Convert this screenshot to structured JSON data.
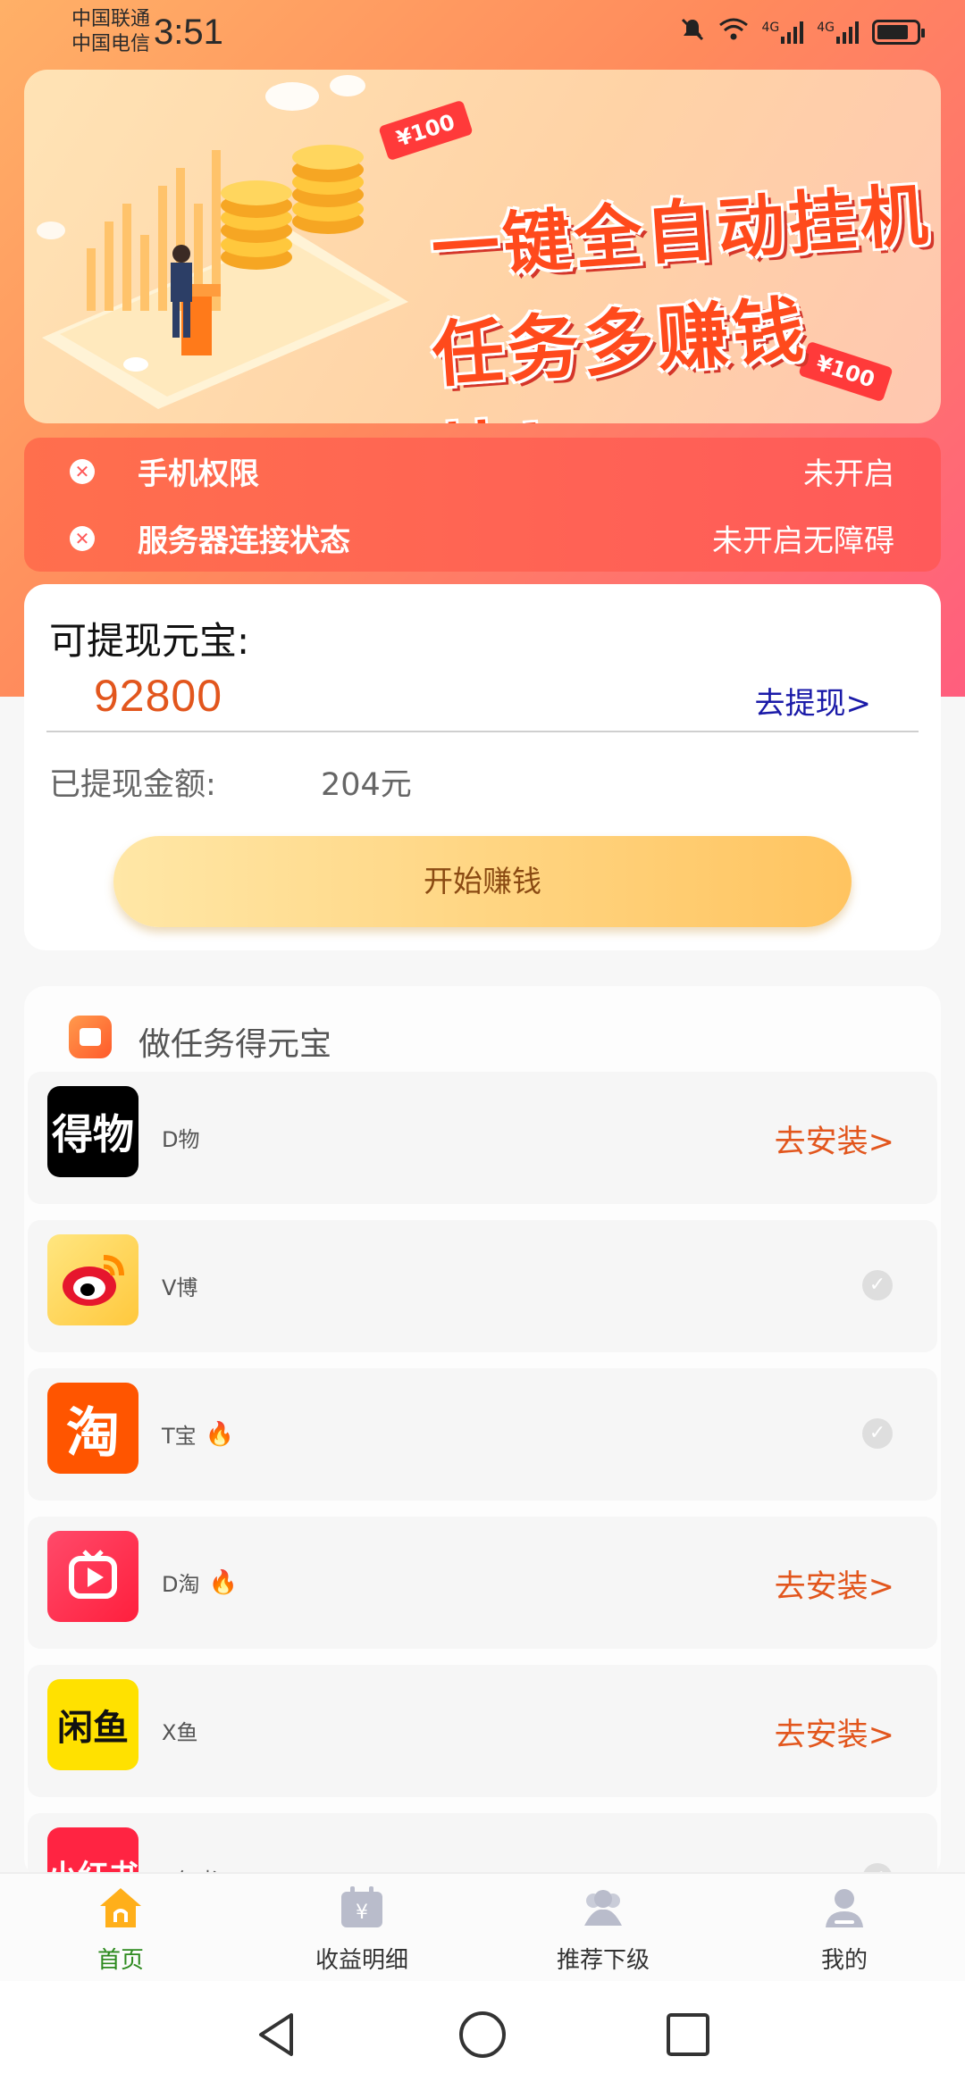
{
  "status_bar": {
    "carrier_1": "中国联通",
    "carrier_2": "中国电信",
    "time": "3:51",
    "net_1": "4G",
    "net_2": "4G"
  },
  "banner": {
    "headline_1": "一键全自动挂机",
    "headline_2": "任务多赚钱快！",
    "tag_1": "¥100",
    "tag_2": "¥100",
    "slide_count": 2,
    "active_slide": 2
  },
  "permissions": {
    "items": [
      {
        "label": "手机权限",
        "status": "未开启"
      },
      {
        "label": "服务器连接状态",
        "status": "未开启无障碍"
      }
    ]
  },
  "withdraw": {
    "title": "可提现元宝:",
    "amount": "92800",
    "link": "去提现>",
    "paid_label": "已提现金额:",
    "paid_value": "204元",
    "start_button": "开始赚钱"
  },
  "tasks": {
    "title": "做任务得元宝",
    "items": [
      {
        "icon_text": "得物",
        "name": "D物",
        "hot": false,
        "action": "去安装>",
        "done": false,
        "icon_bg": "#000000"
      },
      {
        "icon_text": "微",
        "name": "V博",
        "hot": false,
        "action": "",
        "done": true,
        "icon_bg": "#ffd24d"
      },
      {
        "icon_text": "淘",
        "name": "T宝",
        "hot": true,
        "action": "",
        "done": true,
        "icon_bg": "#ff5500"
      },
      {
        "icon_text": "▶",
        "name": "D淘",
        "hot": true,
        "action": "去安装>",
        "done": false,
        "icon_bg": "#ff2d4a"
      },
      {
        "icon_text": "闲鱼",
        "name": "X鱼",
        "hot": false,
        "action": "去安装>",
        "done": false,
        "icon_bg": "#ffe100"
      },
      {
        "icon_text": "小红书",
        "name": "X红书",
        "hot": false,
        "action": "",
        "done": true,
        "icon_bg": "#ff2442"
      }
    ]
  },
  "bottom_nav": {
    "items": [
      {
        "label": "首页",
        "icon": "home-icon",
        "active": true
      },
      {
        "label": "收益明细",
        "icon": "calendar-yen-icon",
        "active": false
      },
      {
        "label": "推荐下级",
        "icon": "users-icon",
        "active": false
      },
      {
        "label": "我的",
        "icon": "user-icon",
        "active": false
      }
    ]
  },
  "colors": {
    "accent": "#e2561d",
    "link_blue": "#1a1aa8",
    "nav_active": "#2d8a1e"
  }
}
